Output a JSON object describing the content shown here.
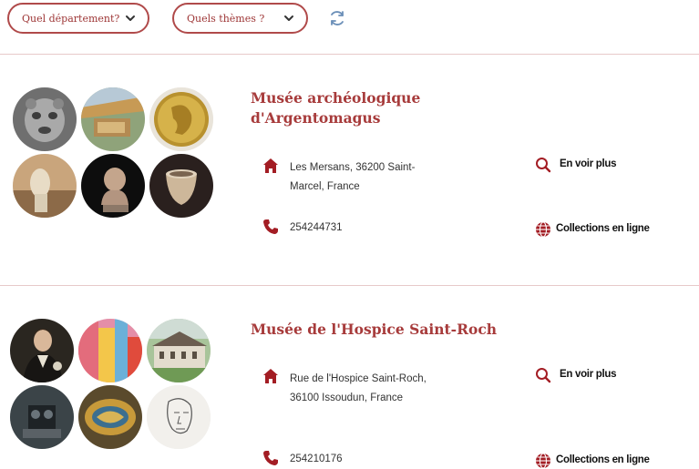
{
  "filters": {
    "department": {
      "label": "Quel département?",
      "icon": "chevron-down-icon"
    },
    "themes": {
      "label": "Quels thèmes ?",
      "icon": "chevron-down-icon"
    },
    "reset_icon": "refresh-icon"
  },
  "colors": {
    "accent": "#a73b3b",
    "border": "#b04a4a",
    "divider": "#e7c9c9"
  },
  "museums": [
    {
      "title_line1": "Musée archéologique",
      "title_line2": "d'Argentomagus",
      "address_line1": "Les Mersans, 36200 Saint-",
      "address_line2": "Marcel, France",
      "phone": "254244731",
      "see_more_label": "En voir plus",
      "collections_label": "Collections en ligne"
    },
    {
      "title_line1": "Musée de l'Hospice Saint-Roch",
      "address_line1": "Rue de l'Hospice Saint-Roch,",
      "address_line2": "36100 Issoudun, France",
      "phone": "254210176",
      "see_more_label": "En voir plus",
      "collections_label": "Collections en ligne"
    }
  ]
}
